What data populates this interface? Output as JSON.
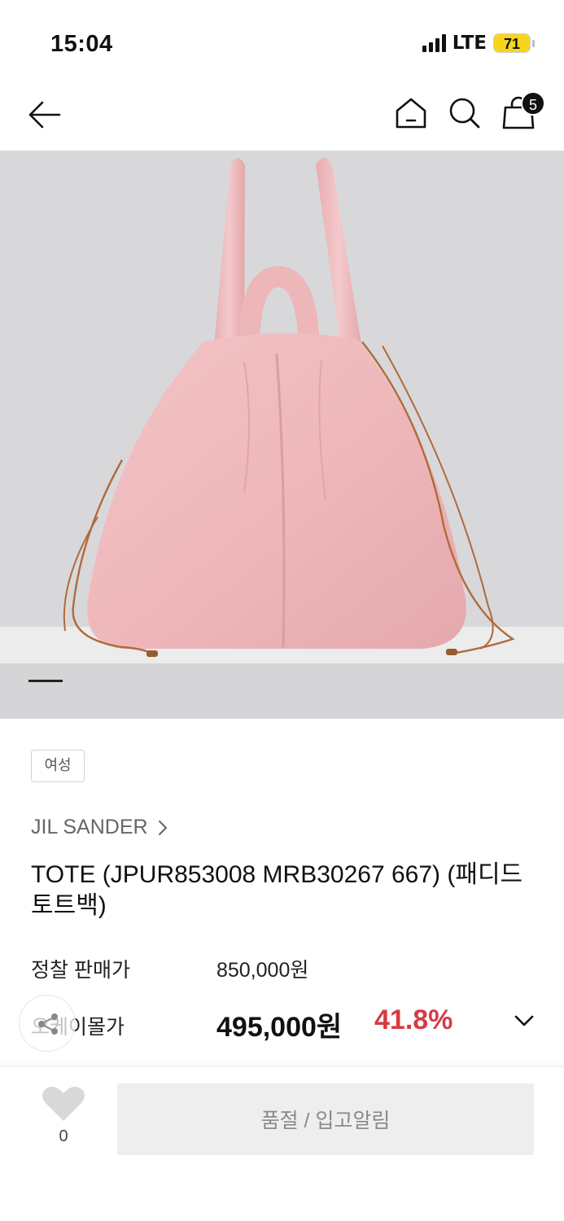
{
  "status_bar": {
    "time": "15:04",
    "network": "LTE",
    "battery": "71"
  },
  "nav": {
    "back_icon": "arrow-left-icon",
    "home_icon": "home-icon",
    "search_icon": "search-icon",
    "cart_icon": "shopping-bag-icon",
    "cart_count": "5"
  },
  "product": {
    "image_alt": "pink padded tote bag",
    "gallery_position": 1,
    "gender_tag": "여성",
    "brand": "JIL SANDER",
    "title": "TOTE (JPUR853008 MRB30267 667) (패디드 토트백)"
  },
  "price": {
    "list_label": "정찰 판매가",
    "list_value": "850,000원",
    "sale_label": "오케이몰가",
    "sale_value": "495,000원",
    "discount_rate": "41.8%",
    "discount_color": "#d63b45"
  },
  "bottom_bar": {
    "like_icon": "heart-icon",
    "like_count": "0",
    "soldout_label": "품절 / 입고알림"
  }
}
